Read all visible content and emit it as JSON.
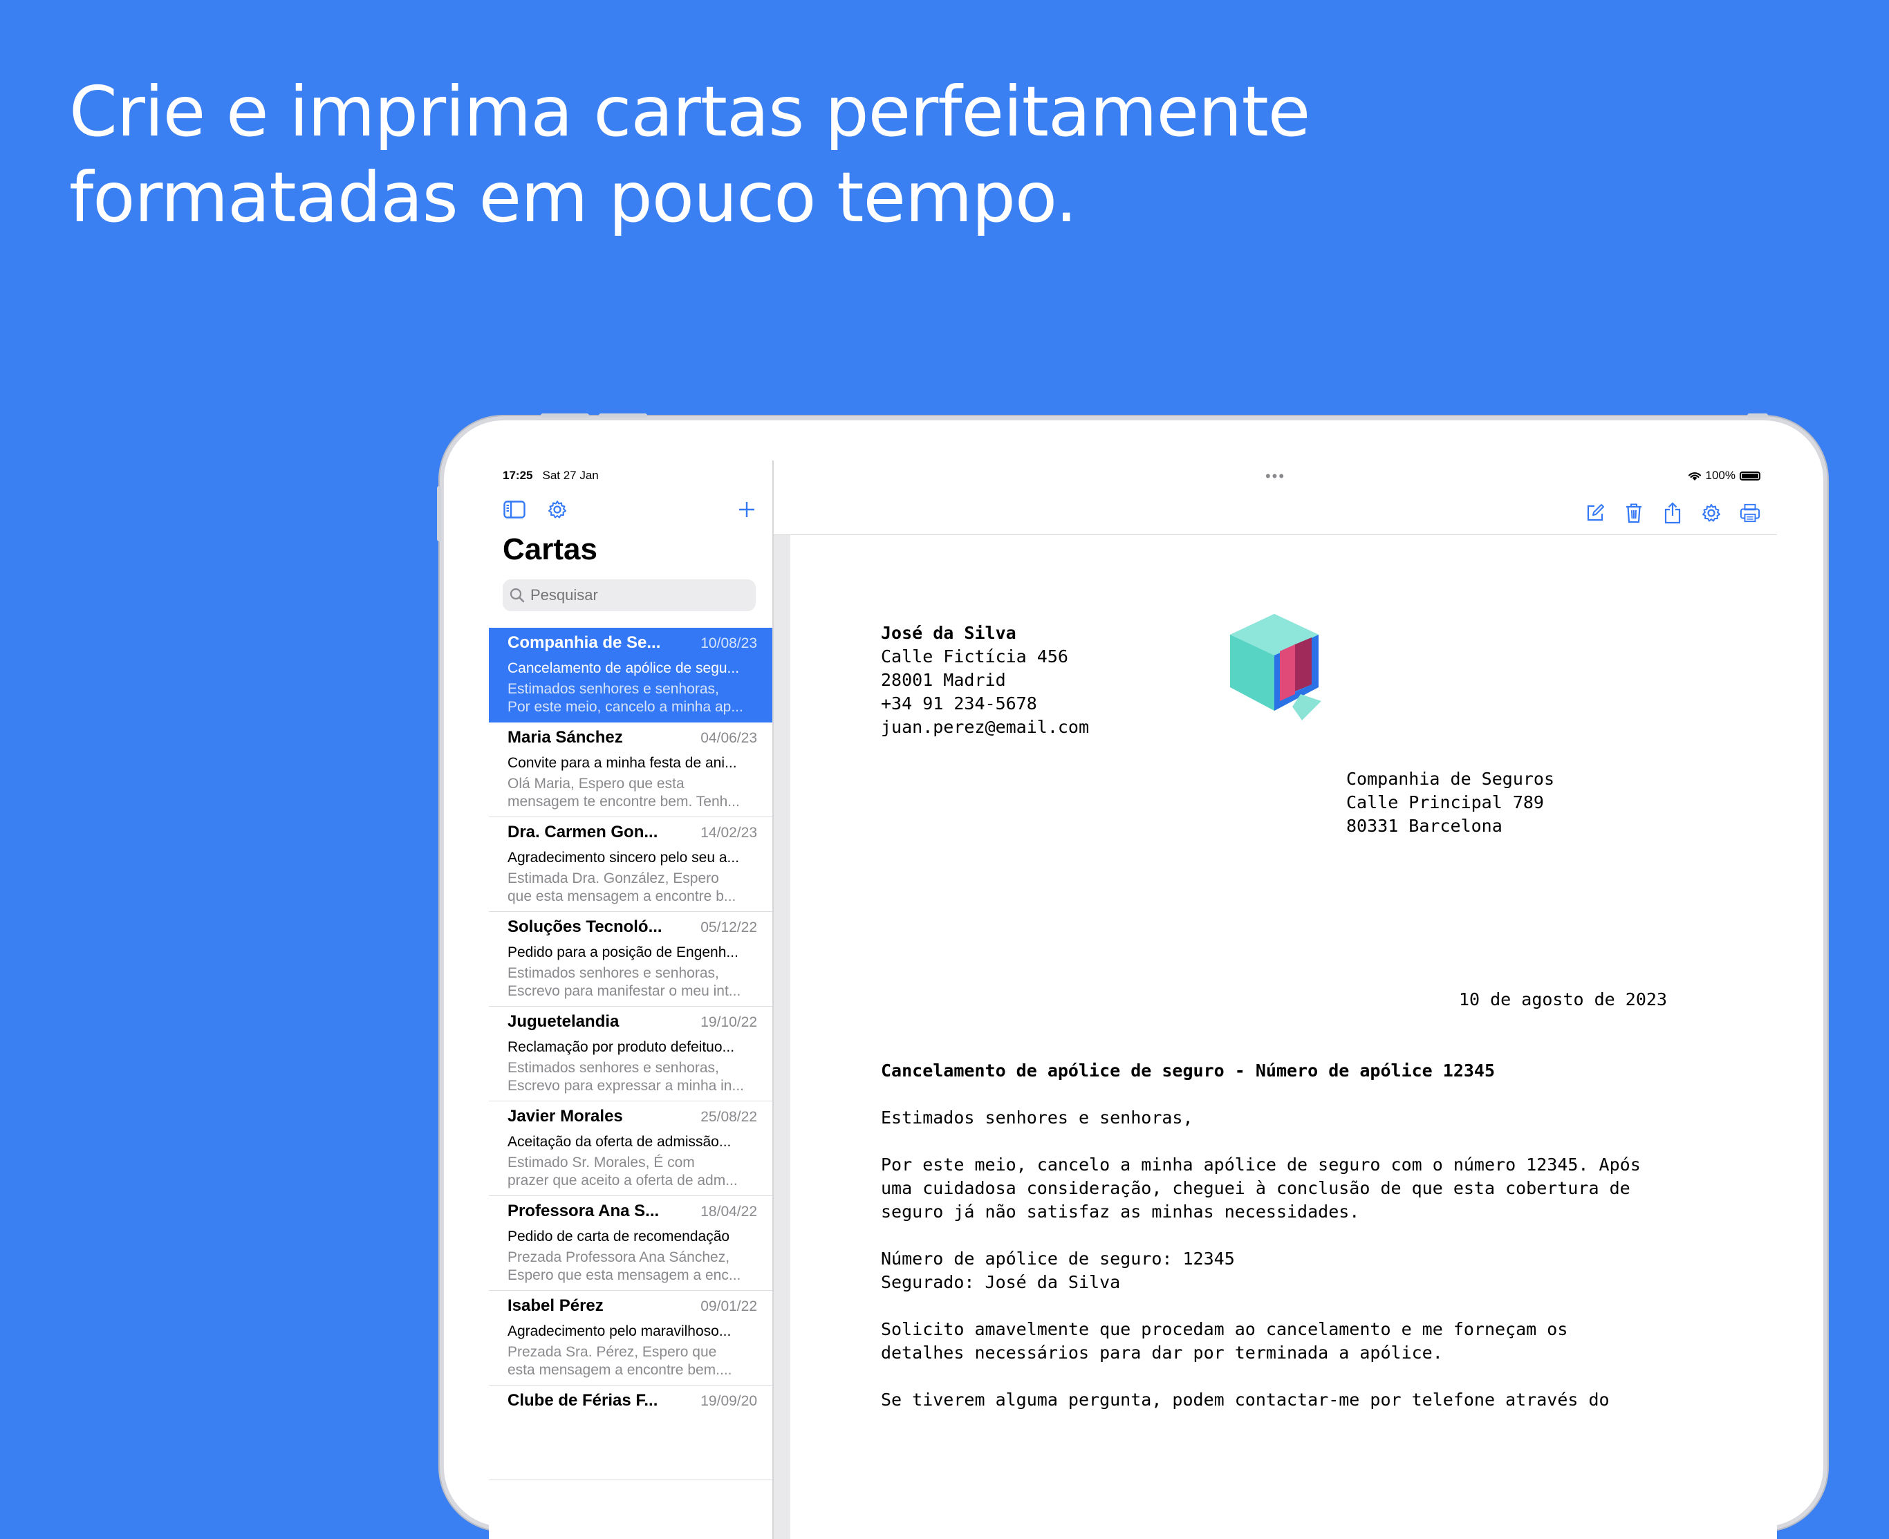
{
  "headline": {
    "line1": "Crie e imprima cartas perfeitamente",
    "line2": "formatadas em pouco tempo."
  },
  "status_bar": {
    "time": "17:25",
    "date": "Sat 27 Jan",
    "battery": "100%"
  },
  "sidebar": {
    "title": "Cartas",
    "search_placeholder": "Pesquisar",
    "items": [
      {
        "from": "Companhia de Se...",
        "date": "10/08/23",
        "subject": "Cancelamento de apólice de segu...",
        "preview1": "Estimados senhores e senhoras,",
        "preview2": "Por este meio, cancelo a minha ap..."
      },
      {
        "from": "Maria Sánchez",
        "date": "04/06/23",
        "subject": "Convite para a minha festa de ani...",
        "preview1": "Olá Maria,  Espero que esta",
        "preview2": "mensagem te encontre bem. Tenh..."
      },
      {
        "from": "Dra. Carmen Gon...",
        "date": "14/02/23",
        "subject": "Agradecimento sincero pelo seu a...",
        "preview1": "Estimada Dra. González,  Espero",
        "preview2": "que esta mensagem a encontre b..."
      },
      {
        "from": "Soluções Tecnoló...",
        "date": "05/12/22",
        "subject": "Pedido para a posição de Engenh...",
        "preview1": "Estimados senhores e senhoras,",
        "preview2": "Escrevo para manifestar o meu int..."
      },
      {
        "from": "Juguetelandia",
        "date": "19/10/22",
        "subject": "Reclamação por produto defeituo...",
        "preview1": "Estimados senhores e senhoras,",
        "preview2": "Escrevo para expressar a minha in..."
      },
      {
        "from": "Javier Morales",
        "date": "25/08/22",
        "subject": "Aceitação da oferta de admissão...",
        "preview1": "Estimado Sr. Morales,  É com",
        "preview2": "prazer que aceito a oferta de adm..."
      },
      {
        "from": "Professora Ana S...",
        "date": "18/04/22",
        "subject": "Pedido de carta de recomendação",
        "preview1": "Prezada Professora Ana Sánchez,",
        "preview2": "Espero que esta mensagem a enc..."
      },
      {
        "from": "Isabel Pérez",
        "date": "09/01/22",
        "subject": "Agradecimento pelo maravilhoso...",
        "preview1": "Prezada Sra. Pérez,  Espero que",
        "preview2": "esta mensagem a encontre bem...."
      },
      {
        "from": "Clube de Férias F...",
        "date": "19/09/20",
        "subject": "",
        "preview1": "",
        "preview2": ""
      }
    ]
  },
  "letter": {
    "sender": {
      "name": "José da Silva",
      "street": "Calle Fictícia 456",
      "city": "28001 Madrid",
      "phone": "+34 91 234-5678",
      "email": "juan.perez@email.com"
    },
    "recipient": {
      "company": "Companhia de Seguros",
      "street": "Calle Principal 789",
      "city": "80331 Barcelona"
    },
    "date": "10 de agosto de 2023",
    "subject": "Cancelamento de apólice de seguro - Número de apólice 12345",
    "greeting": "Estimados senhores e senhoras,",
    "paragraph1": "Por este meio, cancelo a minha apólice de seguro com o número 12345. Após\numa cuidadosa consideração, cheguei à conclusão de que esta cobertura de\nseguro já não satisfaz as minhas necessidades.",
    "paragraph2": "Número de apólice de seguro: 12345\nSegurado: José da Silva",
    "paragraph3": "Solicito amavelmente que procedam ao cancelamento e me forneçam os\ndetalhes necessários para dar por terminada a apólice.",
    "paragraph4": "Se tiverem alguma pergunta, podem contactar-me por telefone através do"
  },
  "icons": {
    "sidebar_toggle": "sidebar-icon",
    "settings": "gear-icon",
    "add": "plus-icon",
    "compose": "compose-icon",
    "delete": "trash-icon",
    "share": "share-icon",
    "print": "printer-icon",
    "search": "search-icon"
  },
  "colors": {
    "background": "#3A80F2",
    "accent": "#3478F6"
  }
}
